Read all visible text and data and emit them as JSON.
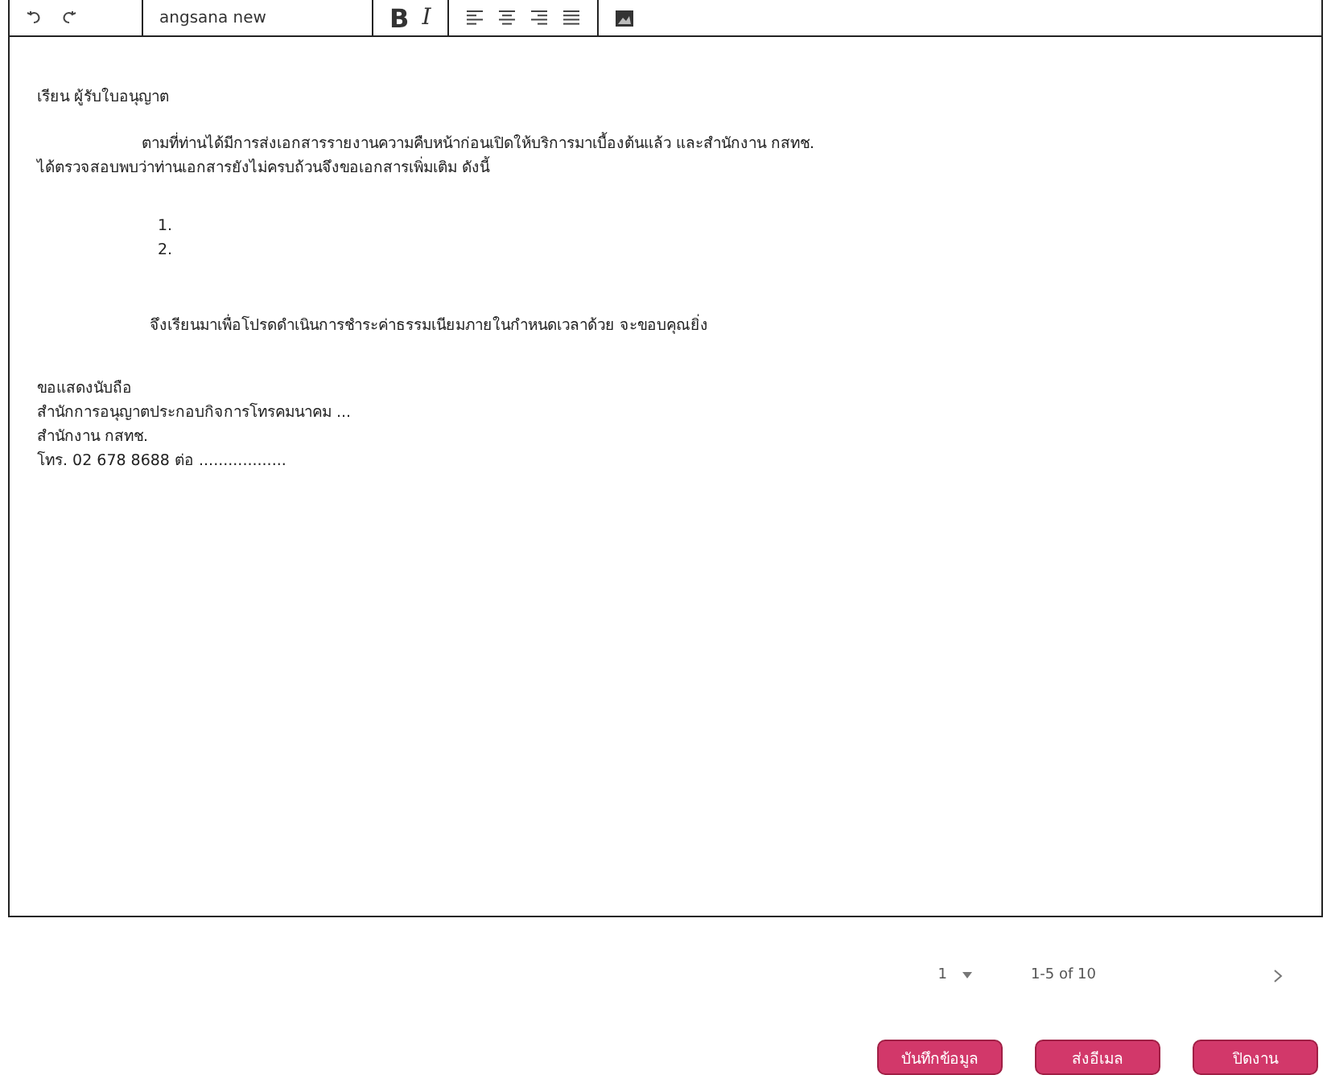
{
  "toolbar": {
    "font": "angsana new",
    "bold": "B",
    "italic": "I"
  },
  "document": {
    "salutation": "เรียน ผู้รับใบอนุญาต",
    "body": [
      "ตามที่ท่านได้มีการส่งเอกสารรายงานความคืบหน้าก่อนเปิดให้บริการมาเบื้องต้นแล้ว และสำนักงาน กสทช.",
      "ได้ตรวจสอบพบว่าท่านเอกสารยังไม่ครบถ้วนจึงขอเอกสารเพิ่มเติม ดังนี้"
    ],
    "list": [
      "1.",
      "2."
    ],
    "closing": "จึงเรียนมาเพื่อโปรดดำเนินการชำระค่าธรรมเนียมภายในกำหนดเวลาด้วย จะขอบคุณยิ่ง",
    "signature": [
      "ขอแสดงนับถือ",
      "สำนักการอนุญาตประกอบกิจการโทรคมนาคม ...",
      "สำนักงาน กสทช.",
      "โทร. 02 678 8688 ต่อ .................."
    ]
  },
  "pagination": {
    "page": "1",
    "range": "1-5 of 10"
  },
  "buttons": [
    "บันทึกข้อมูล",
    "ส่งอีเมล",
    "ปิดงาน"
  ]
}
